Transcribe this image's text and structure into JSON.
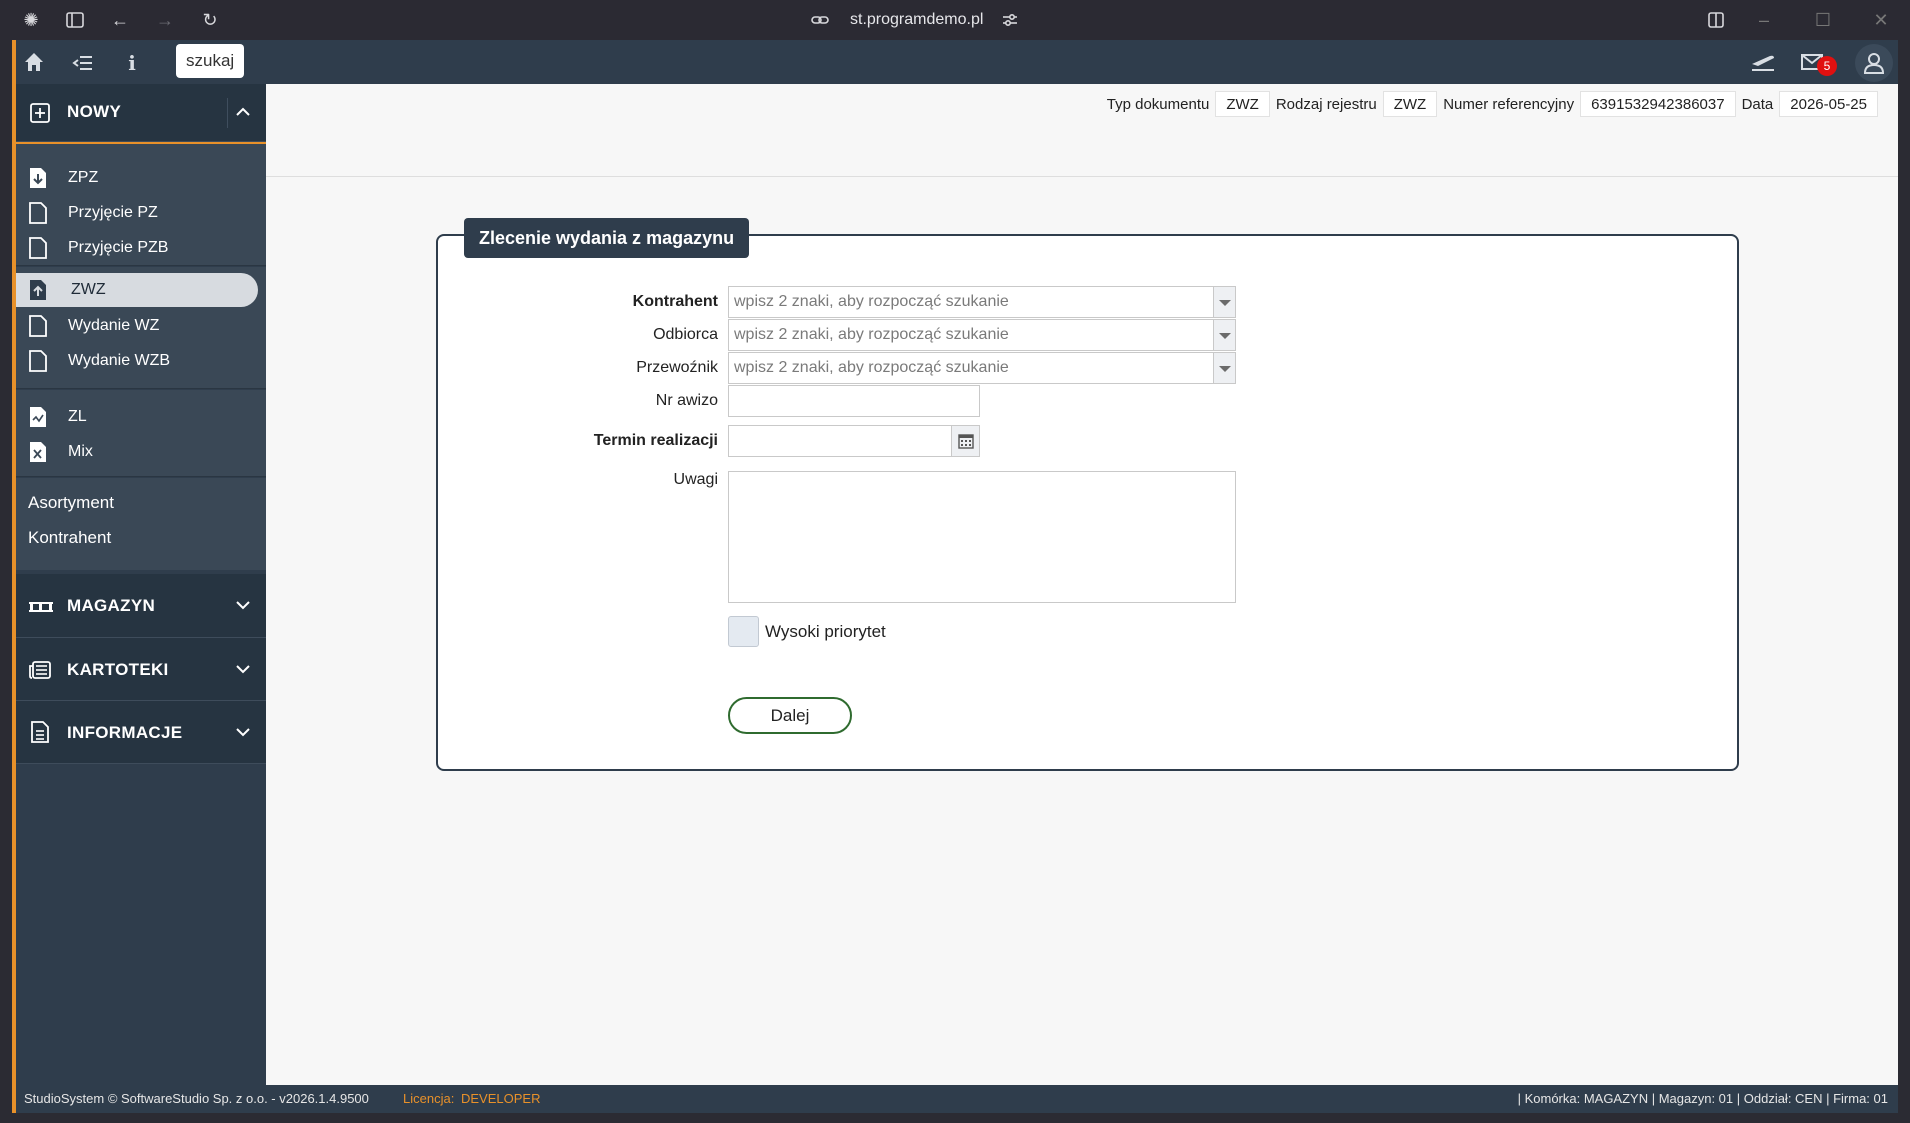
{
  "browser": {
    "url": "st.programdemo.pl"
  },
  "topbar": {
    "search_label": "szukaj",
    "mail_count": "5"
  },
  "sidebar": {
    "new_section": "NOWY",
    "group1": [
      "ZPZ",
      "Przyjęcie PZ",
      "Przyjęcie PZB"
    ],
    "group2_active": "ZWZ",
    "group2": [
      "Wydanie WZ",
      "Wydanie WZB"
    ],
    "group3": [
      "ZL",
      "Mix"
    ],
    "links": [
      "Asortyment",
      "Kontrahent"
    ],
    "sections": [
      "MAGAZYN",
      "KARTOTEKI",
      "INFORMACJE"
    ]
  },
  "meta": {
    "typ_label": "Typ dokumentu",
    "typ_value": "ZWZ",
    "rodzaj_label": "Rodzaj rejestru",
    "rodzaj_value": "ZWZ",
    "numer_label": "Numer referencyjny",
    "numer_value": "6391532942386037",
    "data_label": "Data",
    "data_value": "2026-05-25"
  },
  "form": {
    "title": "Zlecenie wydania z magazynu",
    "kontrahent_label": "Kontrahent",
    "odbiorca_label": "Odbiorca",
    "przewoznik_label": "Przewoźnik",
    "combo_placeholder": "wpisz 2 znaki, aby rozpocząć szukanie",
    "nr_awizo_label": "Nr awizo",
    "nr_awizo_value": "",
    "termin_label": "Termin realizacji",
    "termin_value": "",
    "uwagi_label": "Uwagi",
    "uwagi_value": "",
    "priority_label": "Wysoki priorytet",
    "priority_checked": false,
    "next_button": "Dalej"
  },
  "footer": {
    "left": "StudioSystem © SoftwareStudio Sp. z o.o. - v2026.1.4.9500",
    "license_label": "Licencja:",
    "license_value": "DEVELOPER",
    "right": "| Komórka: MAGAZYN | Magazyn: 01 | Oddział: CEN | Firma: 01"
  },
  "colors": {
    "sidebar_bg": "#2f3d4c",
    "accent_orange": "#e8912a",
    "button_border": "#2f6b2f",
    "badge_red": "#e01010"
  }
}
